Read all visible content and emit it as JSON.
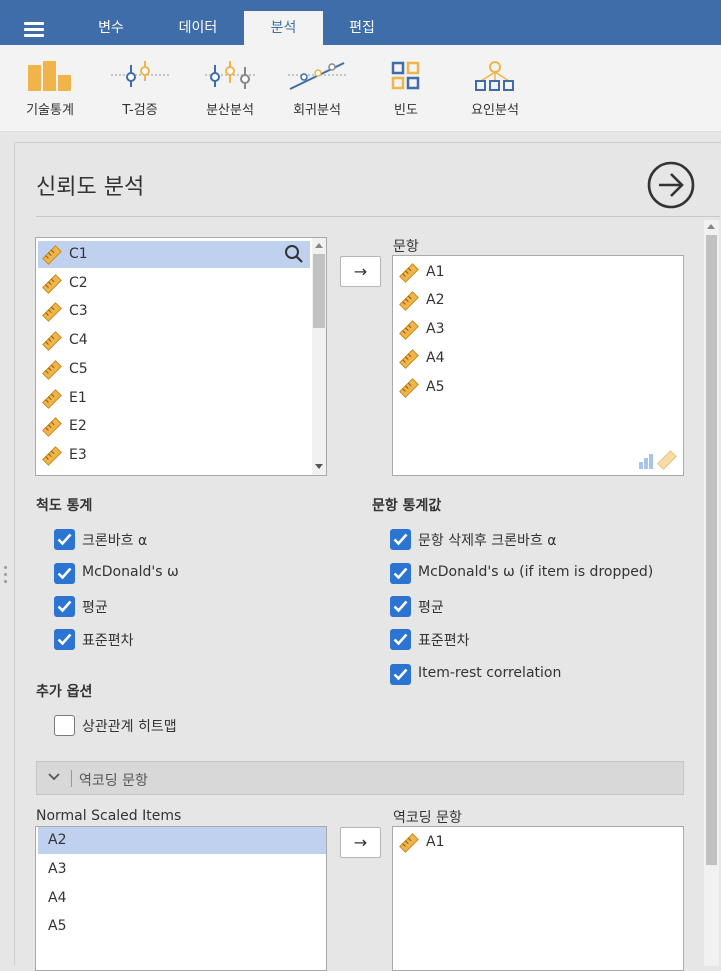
{
  "main_tabs": [
    {
      "label": "변수"
    },
    {
      "label": "데이터"
    },
    {
      "label": "분석"
    },
    {
      "label": "편집"
    }
  ],
  "ribbon": [
    {
      "label": "기술통계",
      "icon": "descriptives-icon"
    },
    {
      "label": "T-검증",
      "icon": "ttest-icon"
    },
    {
      "label": "분산분석",
      "icon": "anova-icon"
    },
    {
      "label": "회귀분석",
      "icon": "regression-icon"
    },
    {
      "label": "빈도",
      "icon": "frequencies-icon"
    },
    {
      "label": "요인분석",
      "icon": "factor-icon"
    }
  ],
  "panel": {
    "title": "신뢰도 분석"
  },
  "variables_list": [
    "C1",
    "C2",
    "C3",
    "C4",
    "C5",
    "E1",
    "E2",
    "E3"
  ],
  "items_box": {
    "label": "문항",
    "items": [
      "A1",
      "A2",
      "A3",
      "A4",
      "A5"
    ]
  },
  "scale_stats": {
    "heading": "척도 통계",
    "options": [
      "크론바흐 α",
      "McDonald's ω",
      "평균",
      "표준편차"
    ],
    "checked": [
      true,
      true,
      true,
      true
    ]
  },
  "item_stats": {
    "heading": "문항 통계값",
    "options": [
      "문항 삭제후 크론바흐 α",
      "McDonald's ω (if item is dropped)",
      "평균",
      "표준편차",
      "Item-rest correlation"
    ],
    "checked": [
      true,
      true,
      true,
      true,
      true
    ]
  },
  "additional": {
    "heading": "추가 옵션",
    "options": [
      "상관관계 히트맵"
    ],
    "checked": [
      false
    ]
  },
  "reverse_section": {
    "header": "역코딩 문항",
    "normal_label": "Normal Scaled Items",
    "normal_items": [
      "A2",
      "A3",
      "A4",
      "A5"
    ],
    "reverse_label": "역코딩 문항",
    "reverse_items": [
      "A1"
    ]
  },
  "colors": {
    "topbar": "#3e6da9",
    "accent": "#2b74d1",
    "ruler": "#f0b54a",
    "selected": "#bfd1ee"
  }
}
